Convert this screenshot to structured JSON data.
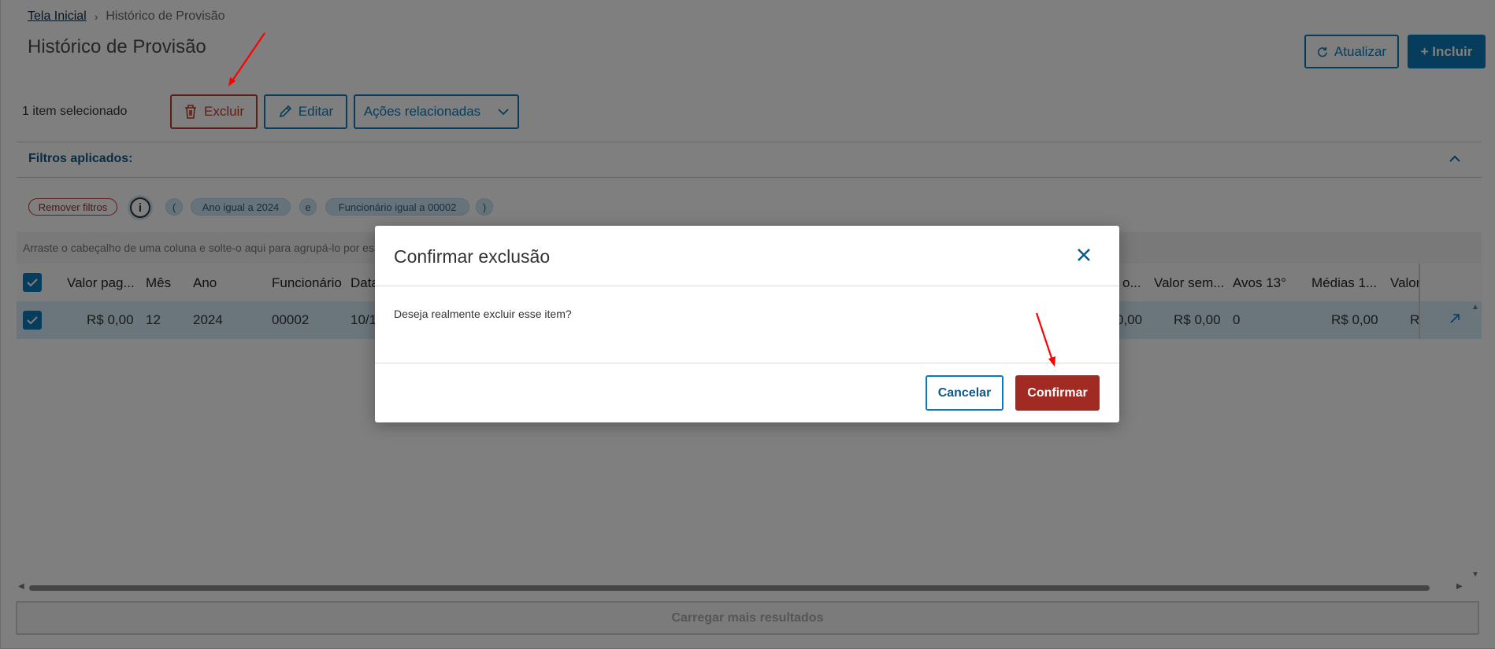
{
  "breadcrumb": {
    "home": "Tela Inicial",
    "current": "Histórico de Provisão"
  },
  "page": {
    "title": "Histórico de Provisão"
  },
  "header_actions": {
    "refresh": "Atualizar",
    "add": "+ Incluir"
  },
  "selection": {
    "count_label": "1 item selecionado"
  },
  "toolbar": {
    "delete": "Excluir",
    "edit": "Editar",
    "related": "Ações relacionadas"
  },
  "filters": {
    "label": "Filtros aplicados:",
    "remove": "Remover filtros",
    "open_paren": "(",
    "filter1": "Ano igual a 2024",
    "and": "e",
    "filter2": "Funcionário igual a 00002",
    "close_paren": ")"
  },
  "grid": {
    "group_hint": "Arraste o cabeçalho de uma coluna e solte-o aqui para agrupá-lo por es",
    "headers": {
      "valor_pago": "Valor pag...",
      "mes": "Mês",
      "ano": "Ano",
      "funcionario": "Funcionário",
      "data": "Data",
      "col_o": "o...",
      "valor_sem": "Valor sem...",
      "avos": "Avos 13°",
      "medias": "Médias 1...",
      "valor_last": "Valor"
    },
    "row": {
      "valor_pago": "R$ 0,00",
      "mes": "12",
      "ano": "2024",
      "funcionario": "00002",
      "data": "10/1",
      "col_o": "0,00",
      "valor_sem": "R$ 0,00",
      "avos": "0",
      "medias": "R$ 0,00",
      "valor_last": "R"
    },
    "load_more": "Carregar mais resultados"
  },
  "modal": {
    "title": "Confirmar exclusão",
    "message": "Deseja realmente excluir esse item?",
    "cancel": "Cancelar",
    "confirm": "Confirmar"
  },
  "colors": {
    "primary": "#0c7ab8",
    "danger": "#a12b22",
    "annotation": "#ff0000"
  }
}
